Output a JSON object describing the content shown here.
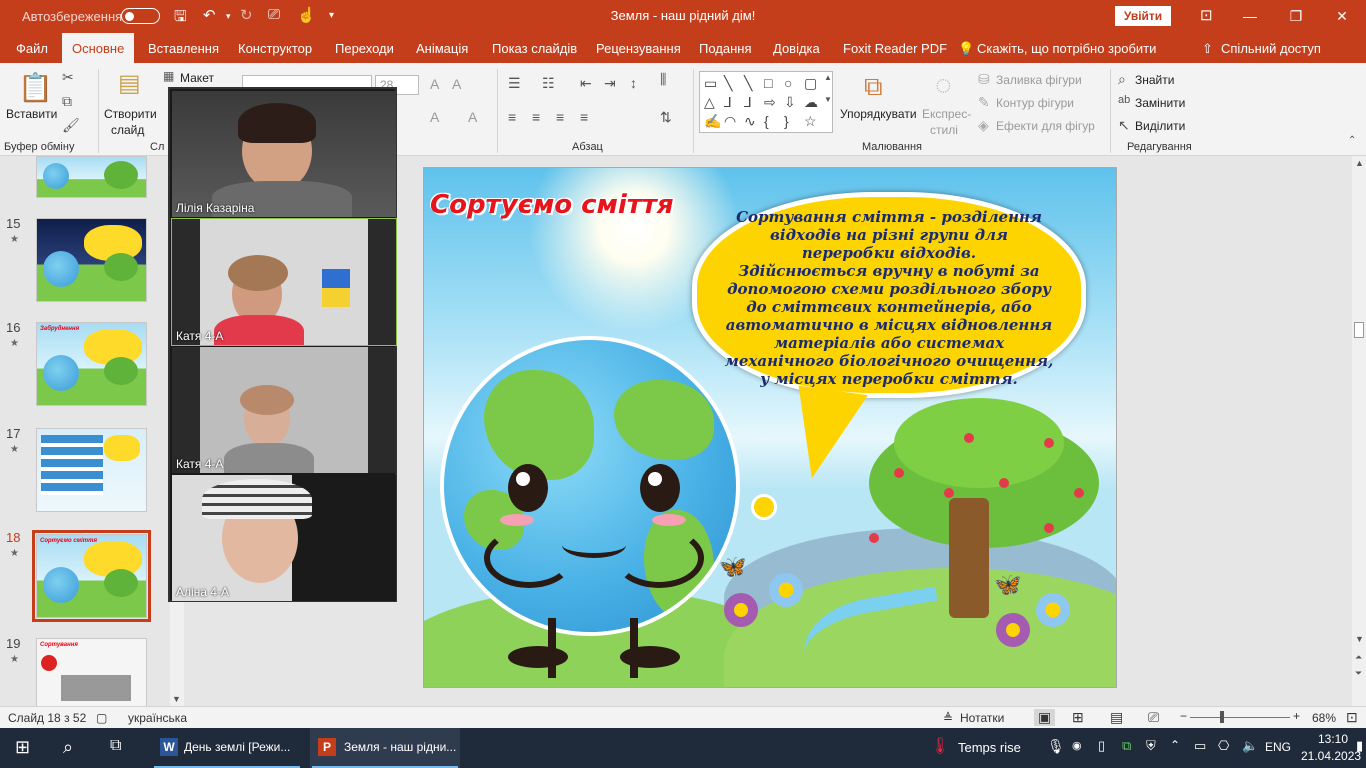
{
  "titlebar": {
    "autosave_label": "Автозбереження",
    "title": "Земля - наш рідний дім!",
    "signin": "Увійти",
    "minimize": "—",
    "restore": "❐",
    "close": "✕"
  },
  "menu": {
    "file": "Файл",
    "home": "Основне",
    "insert": "Вставлення",
    "design": "Конструктор",
    "transitions": "Переходи",
    "animations": "Анімація",
    "slideshow": "Показ слайдів",
    "review": "Рецензування",
    "view": "Подання",
    "help": "Довідка",
    "foxit": "Foxit Reader PDF",
    "tellme": "Скажіть, що потрібно зробити",
    "share": "Спільний доступ"
  },
  "ribbon": {
    "clipboard": {
      "paste": "Вставити",
      "label": "Буфер обміну"
    },
    "slides": {
      "new_slide": "Створити",
      "new_slide2": "слайд",
      "layout": "Макет",
      "label": "Сл"
    },
    "font": {
      "size": "28"
    },
    "paragraph": {
      "label": "Абзац"
    },
    "drawing": {
      "arrange": "Упорядкувати",
      "quick_styles": "Експрес-",
      "quick_styles2": "стилі",
      "fill": "Заливка фігури",
      "outline": "Контур фігури",
      "effects": "Ефекти для фігур",
      "label": "Малювання"
    },
    "editing": {
      "find": "Знайти",
      "replace": "Замінити",
      "select": "Виділити",
      "label": "Редагування"
    }
  },
  "thumbnails": [
    {
      "num": "15",
      "star": "★",
      "title": ""
    },
    {
      "num": "16",
      "star": "★",
      "title": "Забруднення"
    },
    {
      "num": "17",
      "star": "★",
      "title": ""
    },
    {
      "num": "18",
      "star": "★",
      "title": "Сортуємо сміття"
    },
    {
      "num": "19",
      "star": "★",
      "title": "Сортування"
    }
  ],
  "slide": {
    "title": "Сортуємо сміття",
    "bubble_line1": "Сортування сміття - розділення відходів на різні групи для переробки відходів.",
    "bubble_line2": "Здійснюється вручну в побуті за допомогою схеми роздільного збору до сміттєвих контейнерів, або автоматично в місцях відновлення матеріалів або системах механічного біологічного очищення, у місцях переробки сміття."
  },
  "video": {
    "participants": [
      {
        "name": "Лілія Казаріна"
      },
      {
        "name": "Катя  4-А"
      },
      {
        "name": "Катя 4-А"
      },
      {
        "name": "Аліна 4-А"
      }
    ]
  },
  "status": {
    "slide": "Слайд 18 з 52",
    "language": "українська",
    "notes": "Нотатки",
    "zoom": "68%"
  },
  "taskbar": {
    "app1": "День землі [Режи...",
    "app2": "Земля - наш рідни...",
    "weather": "Temps rise",
    "lang": "ENG",
    "time": "13:10",
    "date": "21.04.2023"
  },
  "colors": {
    "accent": "#c43e1c",
    "bubble": "#fed400",
    "title_red": "#e8141b"
  }
}
